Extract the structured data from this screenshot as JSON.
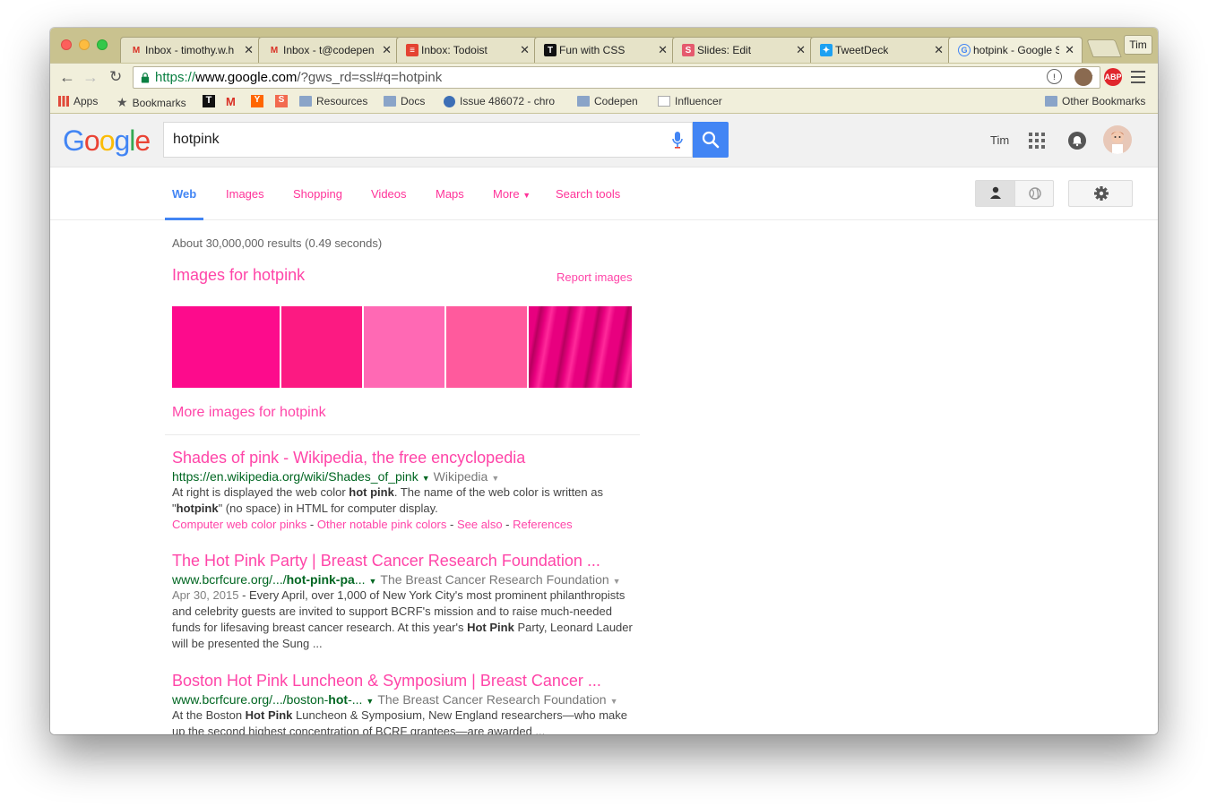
{
  "browser": {
    "tabs": [
      {
        "title": "Inbox - timothy.w.h",
        "favicon": "gmail-icon"
      },
      {
        "title": "Inbox - t@codepen",
        "favicon": "gmail-icon"
      },
      {
        "title": "Inbox: Todoist",
        "favicon": "todoist-icon"
      },
      {
        "title": "Fun with CSS",
        "favicon": "t-icon"
      },
      {
        "title": "Slides: Edit",
        "favicon": "slides-icon"
      },
      {
        "title": "TweetDeck",
        "favicon": "twitter-icon"
      },
      {
        "title": "hotpink - Google S",
        "favicon": "google-icon"
      }
    ],
    "profile_name": "Tim",
    "url_scheme": "https://",
    "url_host": "www.google.com",
    "url_rest": "/?gws_rd=ssl#q=hotpink"
  },
  "bookmarks": {
    "apps": "Apps",
    "bookmarks": "Bookmarks",
    "resources": "Resources",
    "docs": "Docs",
    "issue": "Issue 486072 - chro",
    "codepen": "Codepen",
    "influencer": "Influencer",
    "other": "Other Bookmarks"
  },
  "google": {
    "query": "hotpink",
    "user": "Tim",
    "nav": {
      "web": "Web",
      "images": "Images",
      "shopping": "Shopping",
      "videos": "Videos",
      "maps": "Maps",
      "more": "More",
      "search_tools": "Search tools"
    },
    "results_count": "About 30,000,000 results (0.49 seconds)",
    "images_heading": "Images for hotpink",
    "report_images": "Report images",
    "more_images": "More images for hotpink",
    "thumb_colors": [
      "#fd0b8c",
      "#fc1a82",
      "#ff69b4",
      "#ff5a9d",
      "#e8007f"
    ]
  },
  "results": [
    {
      "title": "Shades of pink - Wikipedia, the free encyclopedia",
      "url": "https://en.wikipedia.org/wiki/Shades_of_pink",
      "source": "Wikipedia",
      "snippet_1": "At right is displayed the web color ",
      "snippet_b1": "hot pink",
      "snippet_2": ". The name of the web color is written as \"",
      "snippet_b2": "hotpink",
      "snippet_3": "\" (no space) in HTML for computer display.",
      "links": [
        "Computer web color pinks",
        "Other notable pink colors",
        "See also",
        "References"
      ]
    },
    {
      "title": "The Hot Pink Party | Breast Cancer Research Foundation ...",
      "url_pre": "www.bcrfcure.org/.../",
      "url_bold": "hot-pink-pa",
      "url_post": "...",
      "source": "The Breast Cancer Research Foundation",
      "date": "Apr 30, 2015",
      "snippet_1": " - Every April, over 1,000 of New York City's most prominent philanthropists and celebrity guests are invited to support BCRF's mission and to raise much-needed funds for lifesaving breast cancer research. At this year's ",
      "snippet_b1": "Hot Pink",
      "snippet_2": " Party, Leonard Lauder will be presented the Sung ..."
    },
    {
      "title": "Boston Hot Pink Luncheon & Symposium | Breast Cancer ...",
      "url_pre": "www.bcrfcure.org/.../boston-",
      "url_bold": "hot",
      "url_post": "-...",
      "source": "The Breast Cancer Research Foundation",
      "snippet_1": "At the Boston ",
      "snippet_b1": "Hot Pink",
      "snippet_2": " Luncheon & Symposium, New England researchers—who make up the second highest concentration of BCRF grantees—are awarded ..."
    }
  ],
  "colors": {
    "link_pink": "#ff45a8",
    "url_green": "#006621",
    "blue": "#4285f4"
  }
}
